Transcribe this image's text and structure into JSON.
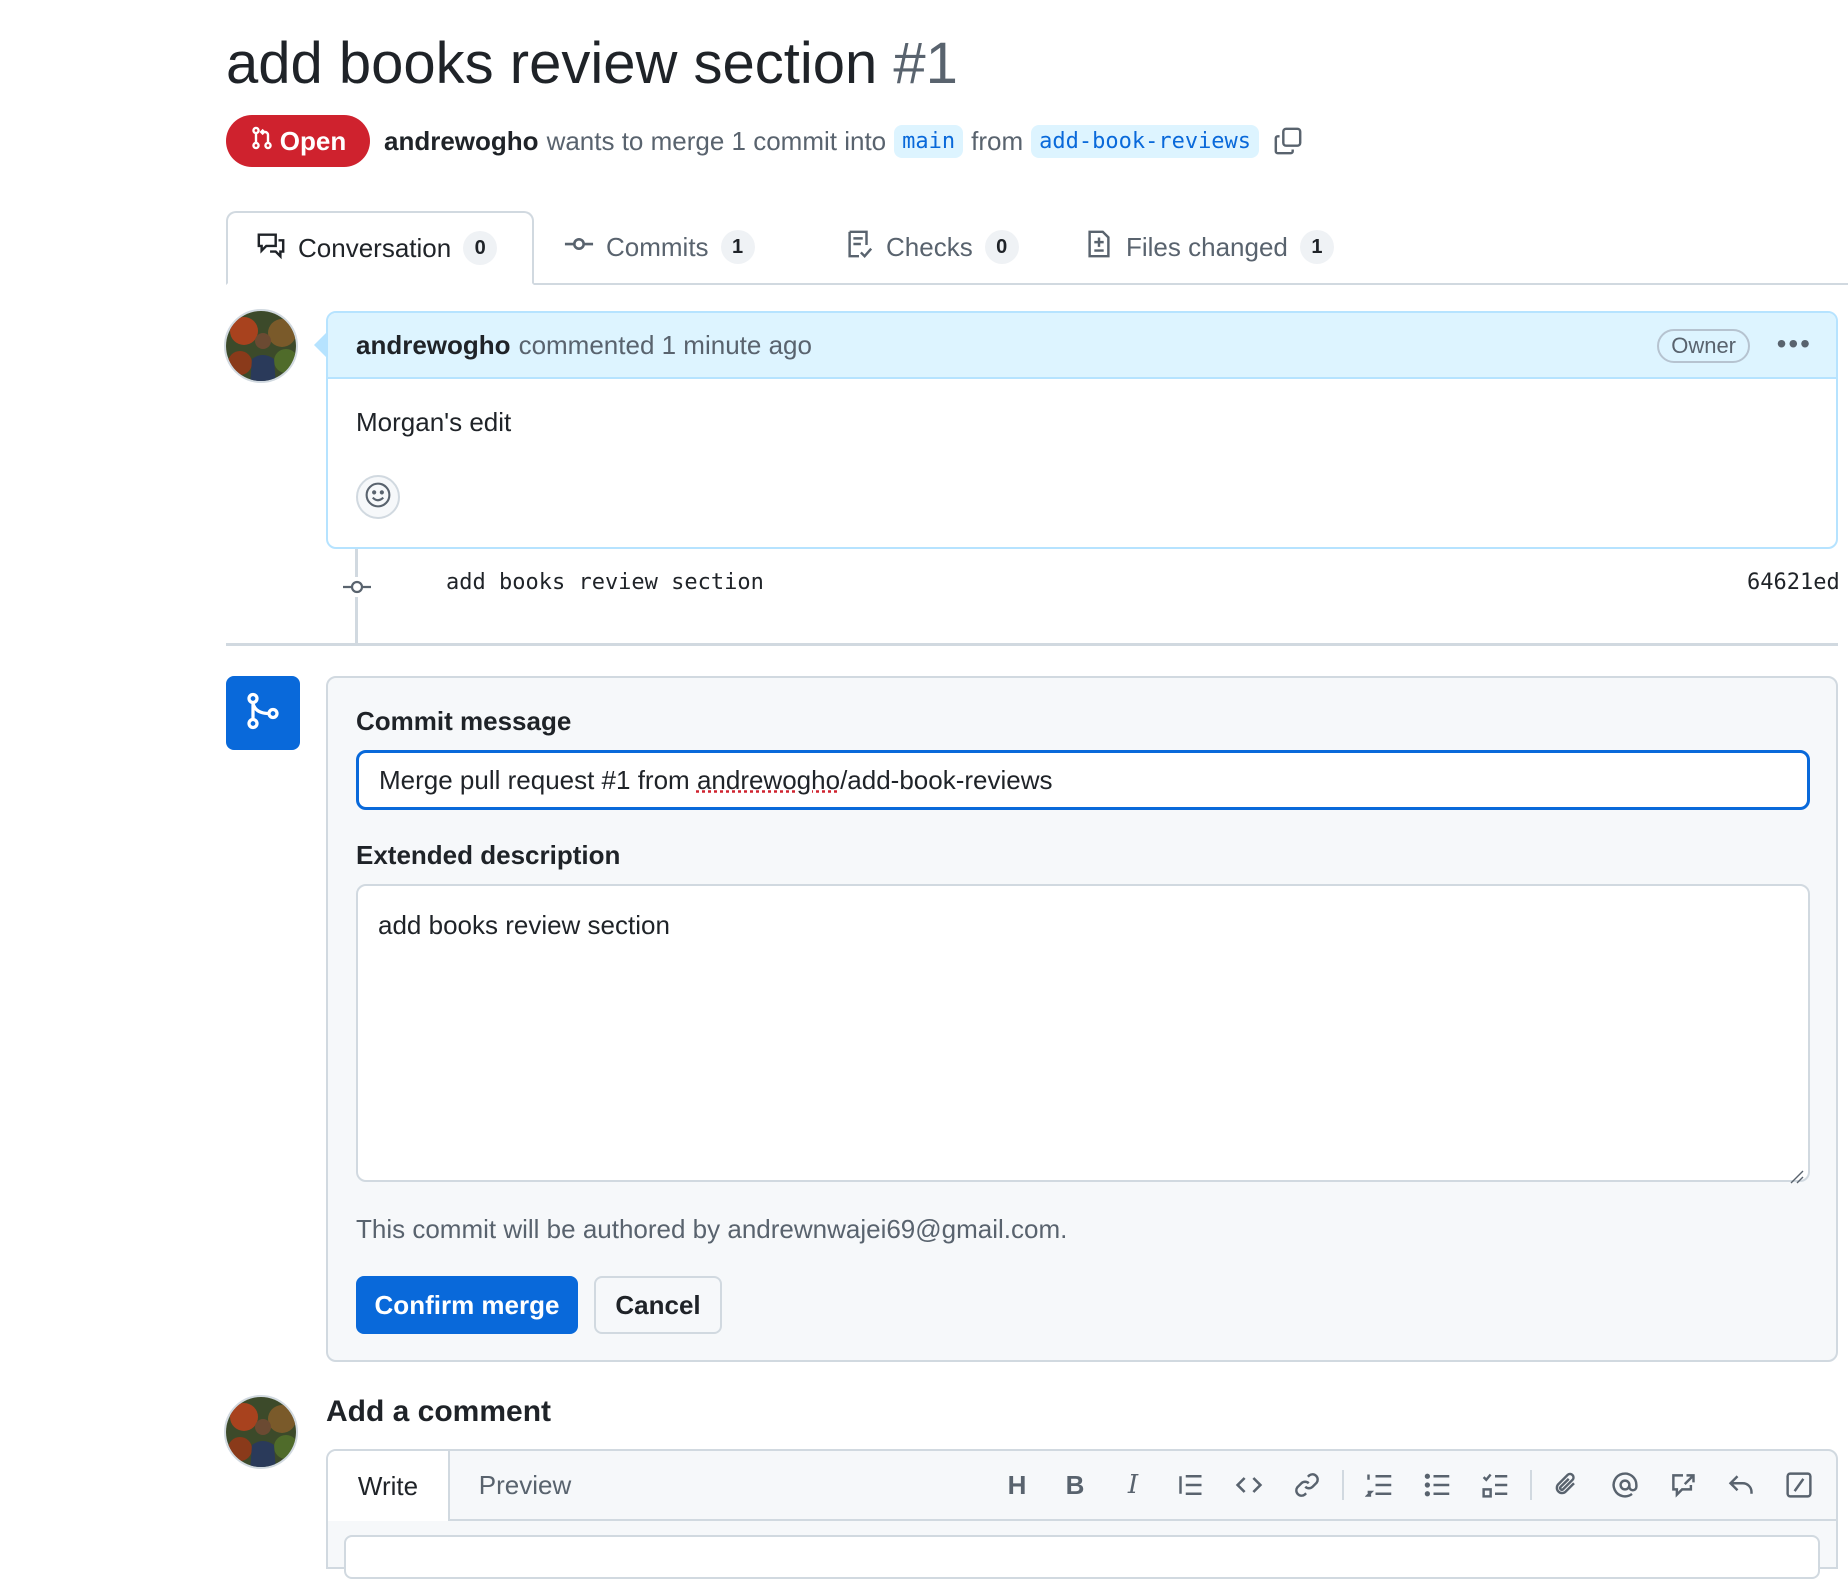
{
  "pr": {
    "title": "add books review section",
    "number": "#1",
    "state": "Open",
    "author": "andrewogho",
    "merge_text": "wants to merge 1 commit into",
    "base_branch": "main",
    "from_text": "from",
    "head_branch": "add-book-reviews"
  },
  "tabs": [
    {
      "label": "Conversation",
      "count": "0",
      "icon": "comment-discussion-icon"
    },
    {
      "label": "Commits",
      "count": "1",
      "icon": "git-commit-icon"
    },
    {
      "label": "Checks",
      "count": "0",
      "icon": "checklist-icon"
    },
    {
      "label": "Files changed",
      "count": "1",
      "icon": "file-diff-icon"
    }
  ],
  "comment": {
    "author": "andrewogho",
    "action": "commented 1 minute ago",
    "badge": "Owner",
    "body": "Morgan's edit"
  },
  "commit": {
    "message": "add books review section",
    "sha": "64621ed"
  },
  "merge": {
    "commit_label": "Commit message",
    "commit_value_prefix": "Merge pull request #1 from ",
    "commit_value_user": "andrewogho",
    "commit_value_suffix": "/add-book-reviews",
    "description_label": "Extended description",
    "description_value": "add books review section",
    "author_note": "This commit will be authored by andrewnwajei69@gmail.com.",
    "confirm_label": "Confirm merge",
    "cancel_label": "Cancel"
  },
  "add_comment": {
    "heading": "Add a comment",
    "write_tab": "Write",
    "preview_tab": "Preview",
    "toolbar": [
      "heading-icon",
      "bold-icon",
      "italic-icon",
      "quote-icon",
      "code-icon",
      "link-icon",
      "numbered-list-icon",
      "bulleted-list-icon",
      "task-list-icon",
      "attach-icon",
      "mention-icon",
      "cross-reference-icon",
      "reply-icon",
      "slash-command-icon"
    ]
  },
  "colors": {
    "accent": "#0969da",
    "open_badge": "#cf222e",
    "comment_header": "#ddf4ff"
  }
}
